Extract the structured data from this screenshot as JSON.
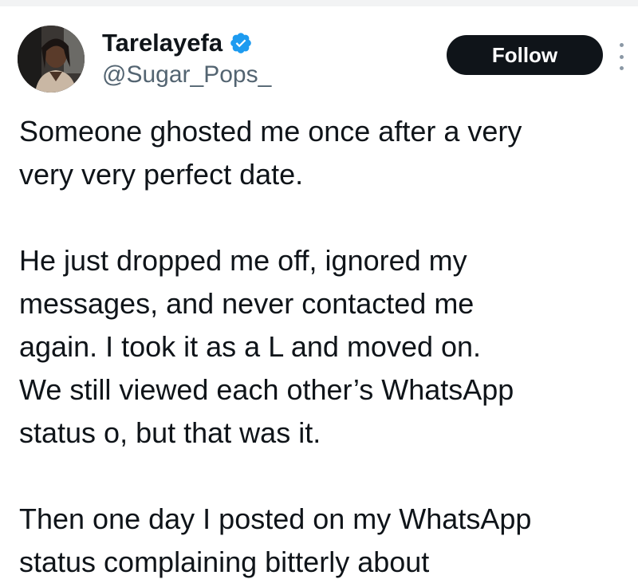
{
  "author": {
    "display_name": "Tarelayefa",
    "handle": "@Sugar_Pops_",
    "verified": true,
    "avatar_icon": "profile-photo",
    "verified_icon": "verified-badge-icon"
  },
  "actions": {
    "follow_label": "Follow",
    "more_icon": "more-options-icon"
  },
  "tweet": {
    "paragraphs": [
      [
        "Someone ghosted me once after a very",
        "very very perfect date."
      ],
      [
        "He just dropped me off, ignored my",
        "messages, and never contacted me",
        "again. I took it as a L and moved on.",
        "We still viewed each other’s WhatsApp",
        "status o, but that was it."
      ],
      [
        "Then one day I posted on my WhatsApp",
        "status complaining bitterly about"
      ]
    ]
  },
  "colors": {
    "text": "#0f1419",
    "secondary_text": "#536471",
    "verified_blue": "#1d9bf0",
    "follow_bg": "#0f1419",
    "follow_text": "#ffffff"
  }
}
